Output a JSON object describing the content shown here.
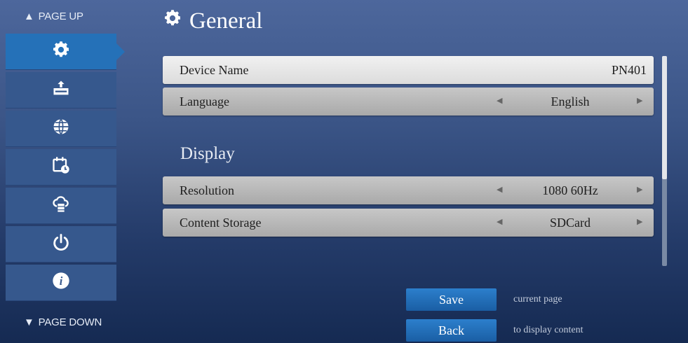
{
  "sidebar": {
    "page_up_label": "PAGE UP",
    "page_down_label": "PAGE DOWN",
    "items": [
      {
        "icon": "gear-icon",
        "active": true
      },
      {
        "icon": "usb-import-icon",
        "active": false
      },
      {
        "icon": "globe-network-icon",
        "active": false
      },
      {
        "icon": "calendar-schedule-icon",
        "active": false
      },
      {
        "icon": "cloud-server-icon",
        "active": false
      },
      {
        "icon": "power-icon",
        "active": false
      },
      {
        "icon": "info-icon",
        "active": false
      }
    ]
  },
  "header": {
    "title": "General",
    "icon": "gear-icon"
  },
  "settings": {
    "device_name": {
      "label": "Device Name",
      "value": "PN401"
    },
    "language": {
      "label": "Language",
      "value": "English"
    }
  },
  "display": {
    "heading": "Display",
    "resolution": {
      "label": "Resolution",
      "value": "1080 60Hz"
    },
    "content_storage": {
      "label": "Content Storage",
      "value": "SDCard"
    }
  },
  "actions": {
    "save_label": "Save",
    "save_hint": "current page",
    "back_label": "Back",
    "back_hint": "to display content"
  },
  "colors": {
    "active_nav": "#2571b8",
    "nav_item": "#36588d",
    "button": "#1f6ab3"
  }
}
